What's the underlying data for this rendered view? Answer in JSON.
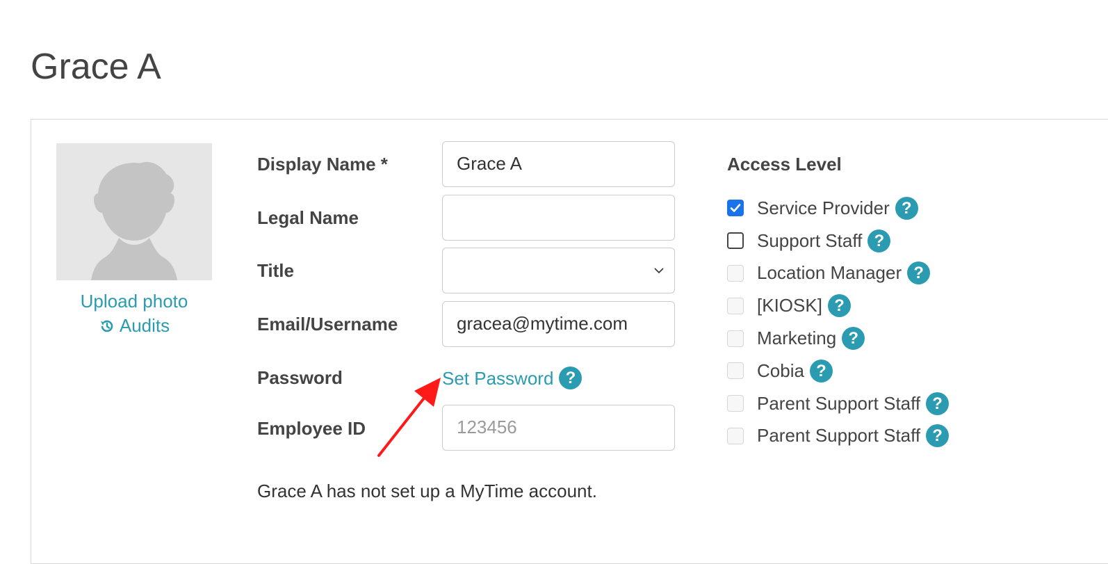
{
  "page": {
    "title": "Grace A"
  },
  "photo": {
    "upload_label": "Upload photo",
    "audits_label": "Audits",
    "audits_icon": "history-icon"
  },
  "form": {
    "display_name": {
      "label": "Display Name *",
      "value": "Grace A"
    },
    "legal_name": {
      "label": "Legal Name",
      "value": ""
    },
    "title": {
      "label": "Title",
      "value": ""
    },
    "email": {
      "label": "Email/Username",
      "value": "gracea@mytime.com"
    },
    "password": {
      "label": "Password",
      "link": "Set Password"
    },
    "employee_id": {
      "label": "Employee ID",
      "placeholder": "123456"
    }
  },
  "notice": "Grace A has not set up a MyTime account.",
  "access": {
    "title": "Access Level",
    "items": [
      {
        "label": "Service Provider",
        "state": "checked"
      },
      {
        "label": "Support Staff",
        "state": "unchecked"
      },
      {
        "label": "Location Manager",
        "state": "disabled"
      },
      {
        "label": "[KIOSK]",
        "state": "disabled"
      },
      {
        "label": "Marketing",
        "state": "disabled"
      },
      {
        "label": "Cobia",
        "state": "disabled"
      },
      {
        "label": "Parent Support Staff",
        "state": "disabled"
      },
      {
        "label": "Parent Support Staff",
        "state": "disabled"
      }
    ]
  },
  "help_glyph": "?",
  "colors": {
    "link": "#2a9bb1",
    "help_badge": "#2a9bb1",
    "checkbox_checked": "#1a73e8",
    "annotation_arrow": "#ff1a1a"
  }
}
